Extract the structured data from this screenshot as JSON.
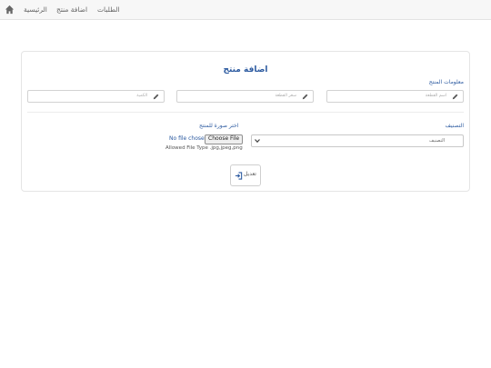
{
  "nav": {
    "home_icon": "home-icon",
    "items": [
      "الطلبات",
      "اضافة منتج",
      "الرئيسية"
    ]
  },
  "form": {
    "title": "اضافة منتج",
    "section_label": "معلومات المنتج",
    "fields": {
      "name_placeholder": "اسم القطعة",
      "price_placeholder": "سعر القطعة",
      "quantity_placeholder": "الكمية"
    },
    "category_label": "التصنيف",
    "category_value": "التصنيف",
    "image_label": "اختر صورة للمنتج",
    "file_button": "Choose File",
    "file_status": "No file chosen",
    "file_types": "Allowed File Type .jpg,jpeg,png",
    "submit_label": "تعديل",
    "submit_icon": "sign-in-icon",
    "pencil_icon": "pencil-icon"
  },
  "colors": {
    "accent": "#2c5aa0",
    "navbar_bg": "#f7f7f7",
    "border": "#d2d2d2"
  }
}
